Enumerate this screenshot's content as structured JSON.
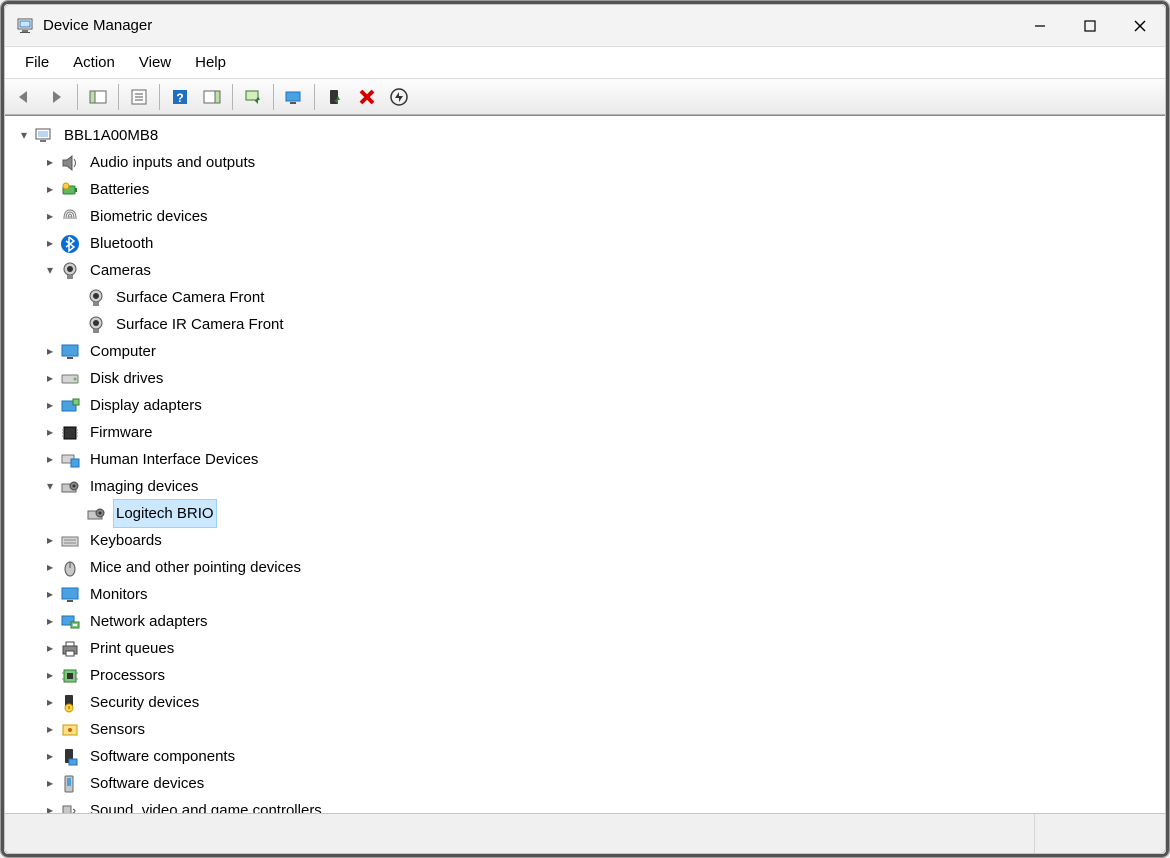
{
  "title": "Device Manager",
  "menu": {
    "file": "File",
    "action": "Action",
    "view": "View",
    "help": "Help"
  },
  "tree": {
    "root": "BBL1A00MB8",
    "audio": "Audio inputs and outputs",
    "batteries": "Batteries",
    "biometric": "Biometric devices",
    "bluetooth": "Bluetooth",
    "cameras": "Cameras",
    "surface_front": "Surface Camera Front",
    "surface_ir": "Surface IR Camera Front",
    "computer": "Computer",
    "disk": "Disk drives",
    "display": "Display adapters",
    "firmware": "Firmware",
    "hid": "Human Interface Devices",
    "imaging": "Imaging devices",
    "logitech_brio": "Logitech BRIO",
    "keyboards": "Keyboards",
    "mice": "Mice and other pointing devices",
    "monitors": "Monitors",
    "network": "Network adapters",
    "print": "Print queues",
    "processors": "Processors",
    "security": "Security devices",
    "sensors": "Sensors",
    "softcomp": "Software components",
    "softdev": "Software devices",
    "sound": "Sound, video and game controllers"
  }
}
